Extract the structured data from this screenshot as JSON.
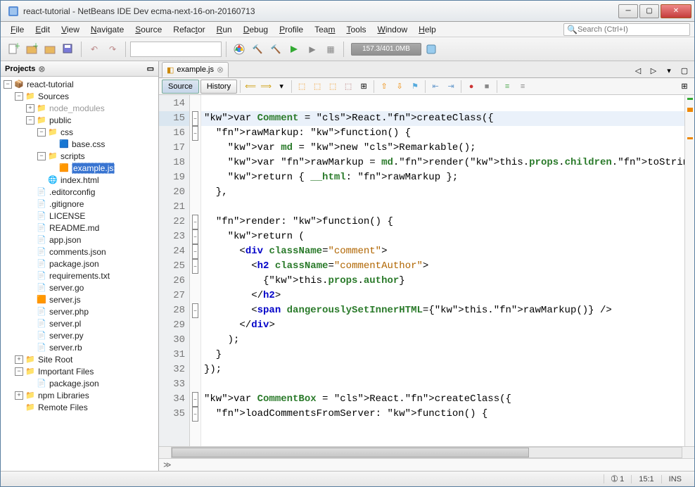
{
  "window": {
    "title": "react-tutorial - NetBeans IDE Dev ecma-next-16-on-20160713"
  },
  "menubar": [
    "File",
    "Edit",
    "View",
    "Navigate",
    "Source",
    "Refactor",
    "Run",
    "Debug",
    "Profile",
    "Team",
    "Tools",
    "Window",
    "Help"
  ],
  "search": {
    "placeholder": "Search (Ctrl+I)"
  },
  "memory": "157.3/401.0MB",
  "projects_panel": {
    "title": "Projects"
  },
  "tree": [
    {
      "d": 0,
      "t": "-",
      "i": "project",
      "l": "react-tutorial"
    },
    {
      "d": 1,
      "t": "-",
      "i": "folder",
      "l": "Sources"
    },
    {
      "d": 2,
      "t": "+",
      "i": "folder",
      "l": "node_modules",
      "dim": true
    },
    {
      "d": 2,
      "t": "-",
      "i": "folder",
      "l": "public"
    },
    {
      "d": 3,
      "t": "-",
      "i": "folder",
      "l": "css"
    },
    {
      "d": 4,
      "t": " ",
      "i": "css",
      "l": "base.css"
    },
    {
      "d": 3,
      "t": "-",
      "i": "folder",
      "l": "scripts"
    },
    {
      "d": 4,
      "t": " ",
      "i": "js",
      "l": "example.js",
      "sel": true
    },
    {
      "d": 3,
      "t": " ",
      "i": "html",
      "l": "index.html"
    },
    {
      "d": 2,
      "t": " ",
      "i": "file",
      "l": ".editorconfig"
    },
    {
      "d": 2,
      "t": " ",
      "i": "file",
      "l": ".gitignore"
    },
    {
      "d": 2,
      "t": " ",
      "i": "file",
      "l": "LICENSE"
    },
    {
      "d": 2,
      "t": " ",
      "i": "file",
      "l": "README.md"
    },
    {
      "d": 2,
      "t": " ",
      "i": "json",
      "l": "app.json"
    },
    {
      "d": 2,
      "t": " ",
      "i": "json",
      "l": "comments.json"
    },
    {
      "d": 2,
      "t": " ",
      "i": "json",
      "l": "package.json"
    },
    {
      "d": 2,
      "t": " ",
      "i": "file",
      "l": "requirements.txt"
    },
    {
      "d": 2,
      "t": " ",
      "i": "go",
      "l": "server.go"
    },
    {
      "d": 2,
      "t": " ",
      "i": "js",
      "l": "server.js"
    },
    {
      "d": 2,
      "t": " ",
      "i": "php",
      "l": "server.php"
    },
    {
      "d": 2,
      "t": " ",
      "i": "pl",
      "l": "server.pl"
    },
    {
      "d": 2,
      "t": " ",
      "i": "py",
      "l": "server.py"
    },
    {
      "d": 2,
      "t": " ",
      "i": "rb",
      "l": "server.rb"
    },
    {
      "d": 1,
      "t": "+",
      "i": "folder",
      "l": "Site Root"
    },
    {
      "d": 1,
      "t": "-",
      "i": "folder",
      "l": "Important Files"
    },
    {
      "d": 2,
      "t": " ",
      "i": "json",
      "l": "package.json"
    },
    {
      "d": 1,
      "t": "+",
      "i": "folder",
      "l": "npm Libraries"
    },
    {
      "d": 1,
      "t": " ",
      "i": "folder",
      "l": "Remote Files"
    }
  ],
  "editor": {
    "tab": "example.js",
    "views": {
      "source": "Source",
      "history": "History"
    },
    "first_line": 14,
    "current_line": 15,
    "fold_lines": [
      15,
      16,
      22,
      23,
      24,
      25,
      28,
      34,
      35
    ],
    "lines": [
      "",
      "var Comment = React.createClass({",
      "  rawMarkup: function() {",
      "    var md = new Remarkable();",
      "    var rawMarkup = md.render(this.props.children.toString());",
      "    return { __html: rawMarkup };",
      "  },",
      "",
      "  render: function() {",
      "    return (",
      "      <div className=\"comment\">",
      "        <h2 className=\"commentAuthor\">",
      "          {this.props.author}",
      "        </h2>",
      "        <span dangerouslySetInnerHTML={this.rawMarkup()} />",
      "      </div>",
      "    );",
      "  }",
      "});",
      "",
      "var CommentBox = React.createClass({",
      "  loadCommentsFromServer: function() {"
    ]
  },
  "status": {
    "notif": "1",
    "pos": "15:1",
    "ins": "INS"
  }
}
